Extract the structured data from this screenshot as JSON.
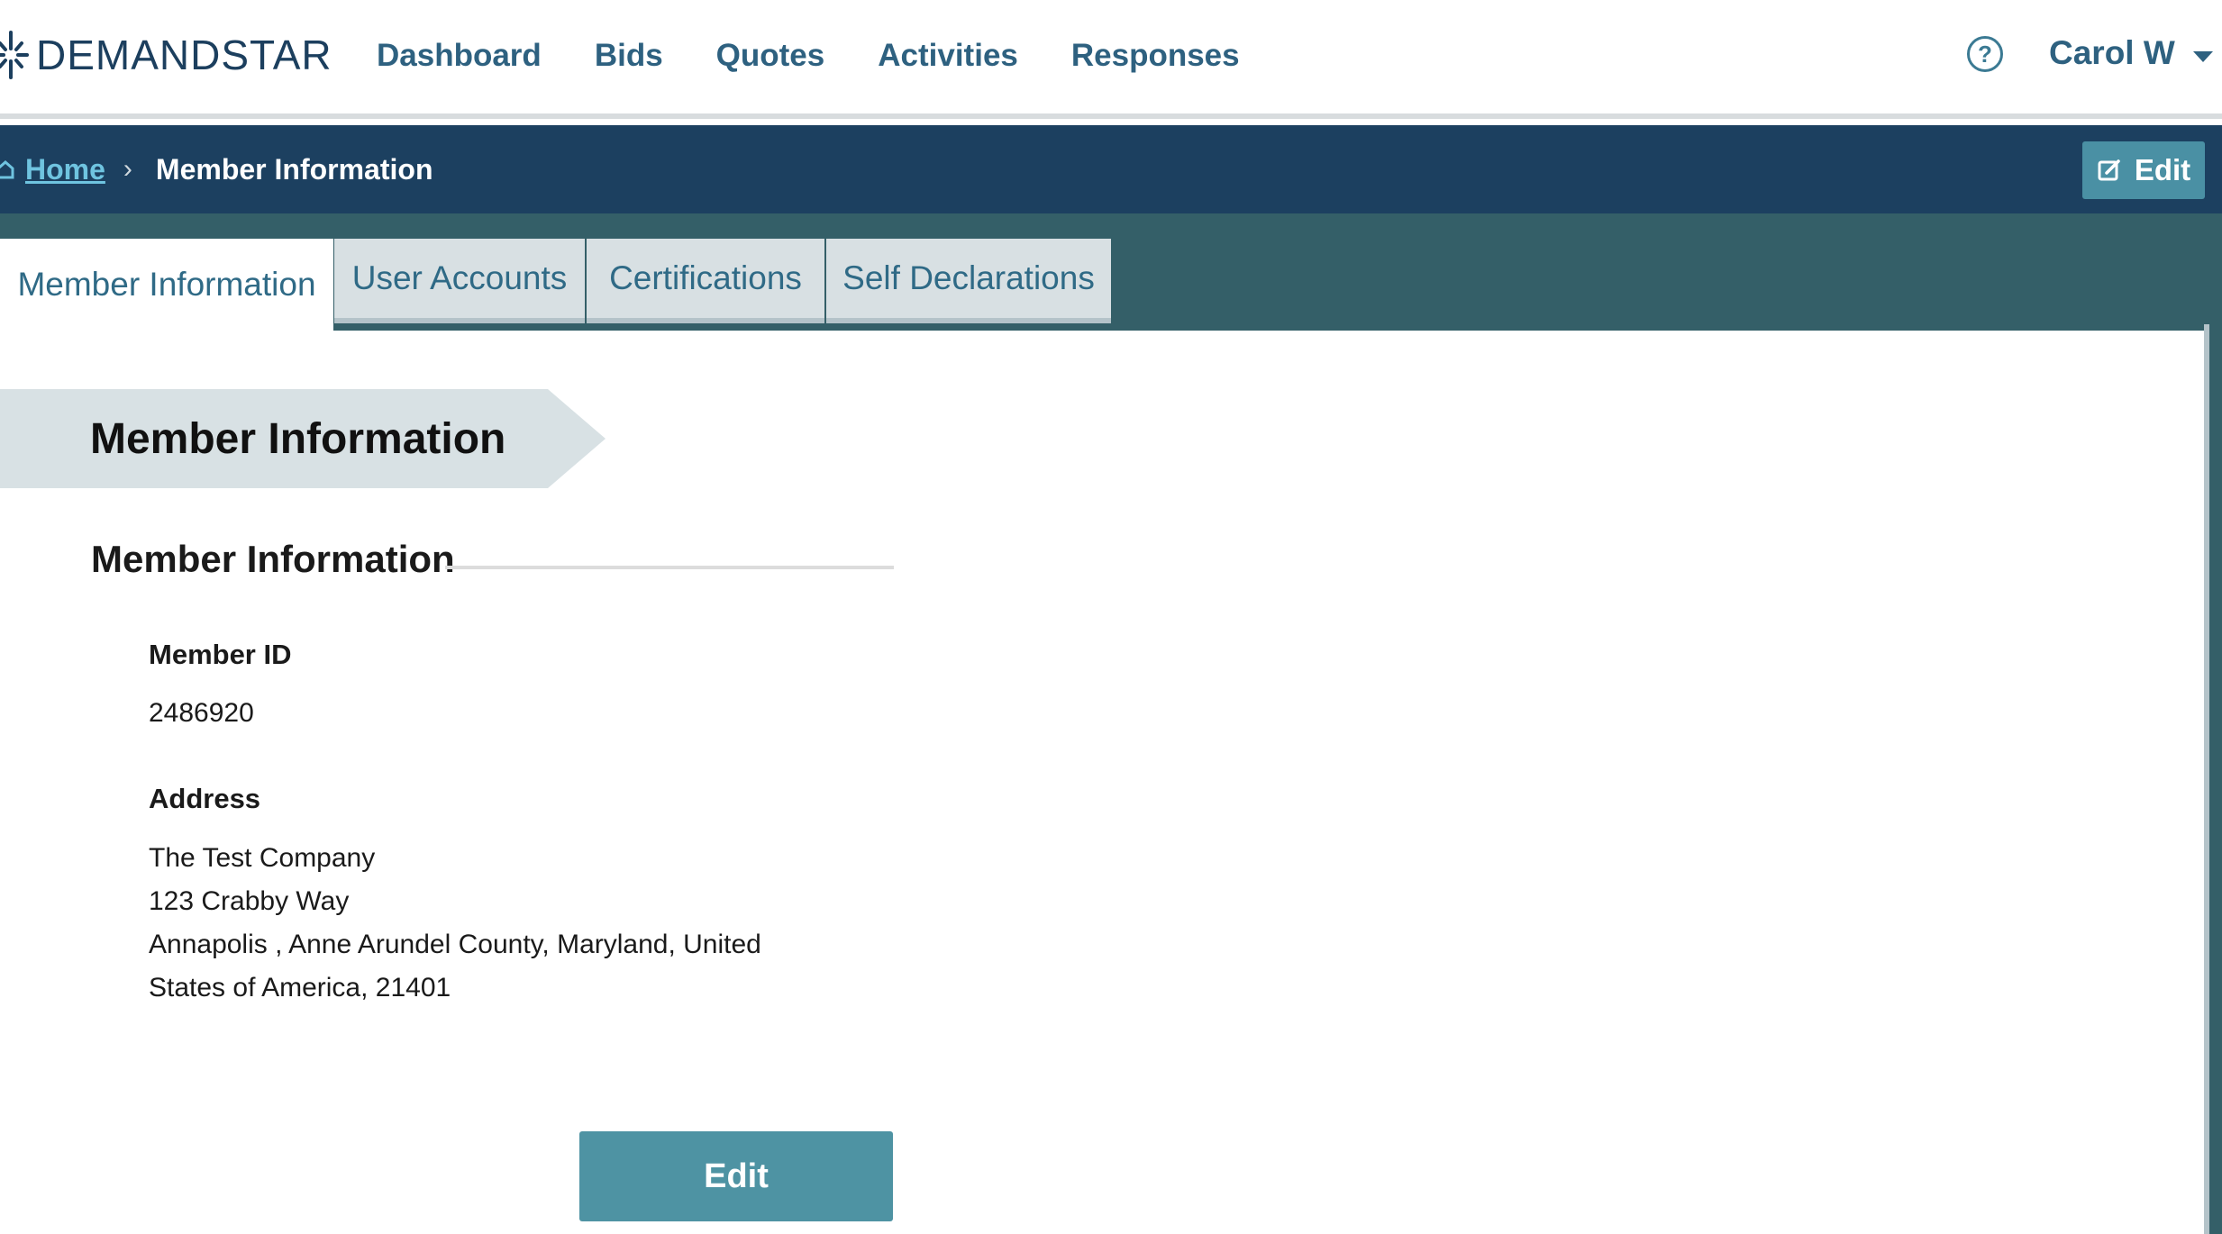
{
  "brand": {
    "name": "DEMANDSTAR"
  },
  "nav": {
    "items": [
      {
        "label": "Dashboard"
      },
      {
        "label": "Bids"
      },
      {
        "label": "Quotes"
      },
      {
        "label": "Activities"
      },
      {
        "label": "Responses"
      }
    ]
  },
  "header": {
    "help_icon": "question-circle-icon",
    "user_name": "Carol W"
  },
  "breadcrumb": {
    "home_label": "Home",
    "current_label": "Member Information",
    "edit_label": "Edit"
  },
  "tabs": [
    {
      "label": "Member Information",
      "active": true
    },
    {
      "label": "User Accounts",
      "active": false
    },
    {
      "label": "Certifications",
      "active": false
    },
    {
      "label": "Self Declarations",
      "active": false
    }
  ],
  "page": {
    "banner_title": "Member Information",
    "section_title": "Member Information",
    "member_id_label": "Member ID",
    "member_id_value": "2486920",
    "address_label": "Address",
    "address_lines": [
      "The Test Company",
      "123 Crabby Way",
      "Annapolis , Anne Arundel County, Maryland, United",
      "States of America, 21401"
    ],
    "edit_button_label": "Edit"
  },
  "colors": {
    "navy": "#1c4060",
    "teal_band": "#345f68",
    "button_teal": "#4e93a3",
    "link_blue": "#6fc4e0",
    "nav_text": "#2e6180"
  }
}
